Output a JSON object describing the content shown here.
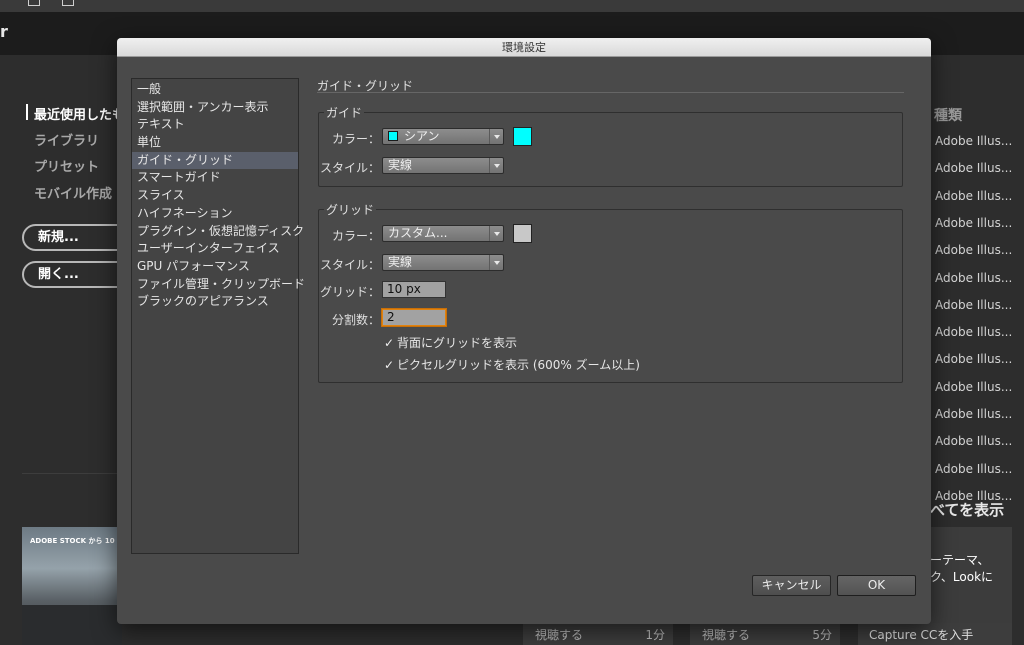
{
  "background_app": {
    "app_letter": "r",
    "nav": [
      {
        "label": "最近使用したも",
        "active": true
      },
      {
        "label": "ライブラリ",
        "active": false
      },
      {
        "label": "プリセット",
        "active": false
      },
      {
        "label": "モバイル作成",
        "active": false
      }
    ],
    "new_button": "新規...",
    "open_button": "開く...",
    "stock_banner": "ADOBE STOCK から 10",
    "kind_header": "種類",
    "kind_items": [
      "Adobe Illus...",
      "Adobe Illus...",
      "Adobe Illus...",
      "Adobe Illus...",
      "Adobe Illus...",
      "Adobe Illus...",
      "Adobe Illus...",
      "Adobe Illus...",
      "Adobe Illus...",
      "Adobe Illus...",
      "Adobe Illus...",
      "Adobe Illus...",
      "Adobe Illus...",
      "Adobe Illus..."
    ],
    "show_all": "べてを表示",
    "feature_line1": "ーテーマ、",
    "feature_line2": "ク、Lookに",
    "cards": [
      {
        "label": "視聴する",
        "duration": "1分"
      },
      {
        "label": "視聴する",
        "duration": "5分"
      }
    ],
    "capture_label": "Capture CCを入手"
  },
  "dialog": {
    "title": "環境設定",
    "categories": [
      "一般",
      "選択範囲・アンカー表示",
      "テキスト",
      "単位",
      "ガイド・グリッド",
      "スマートガイド",
      "スライス",
      "ハイフネーション",
      "プラグイン・仮想記憶ディスク",
      "ユーザーインターフェイス",
      "GPU パフォーマンス",
      "ファイル管理・クリップボード",
      "ブラックのアピアランス"
    ],
    "selected_category": "ガイド・グリッド",
    "section_title": "ガイド・グリッド",
    "guide": {
      "group_title": "ガイド",
      "color_label": "カラー：",
      "color_value": "シアン",
      "color_hex": "#00ffff",
      "style_label": "スタイル：",
      "style_value": "実線"
    },
    "grid": {
      "group_title": "グリッド",
      "color_label": "カラー：",
      "color_value": "カスタム...",
      "color_hex": "#c8c8c8",
      "style_label": "スタイル：",
      "style_value": "実線",
      "gridline_label": "グリッド：",
      "gridline_value": "10 px",
      "subdiv_label": "分割数：",
      "subdiv_value": "2",
      "back_check": "背面にグリッドを表示",
      "pixel_check": "ピクセルグリッドを表示 (600% ズーム以上)"
    },
    "cancel_label": "キャンセル",
    "ok_label": "OK"
  }
}
